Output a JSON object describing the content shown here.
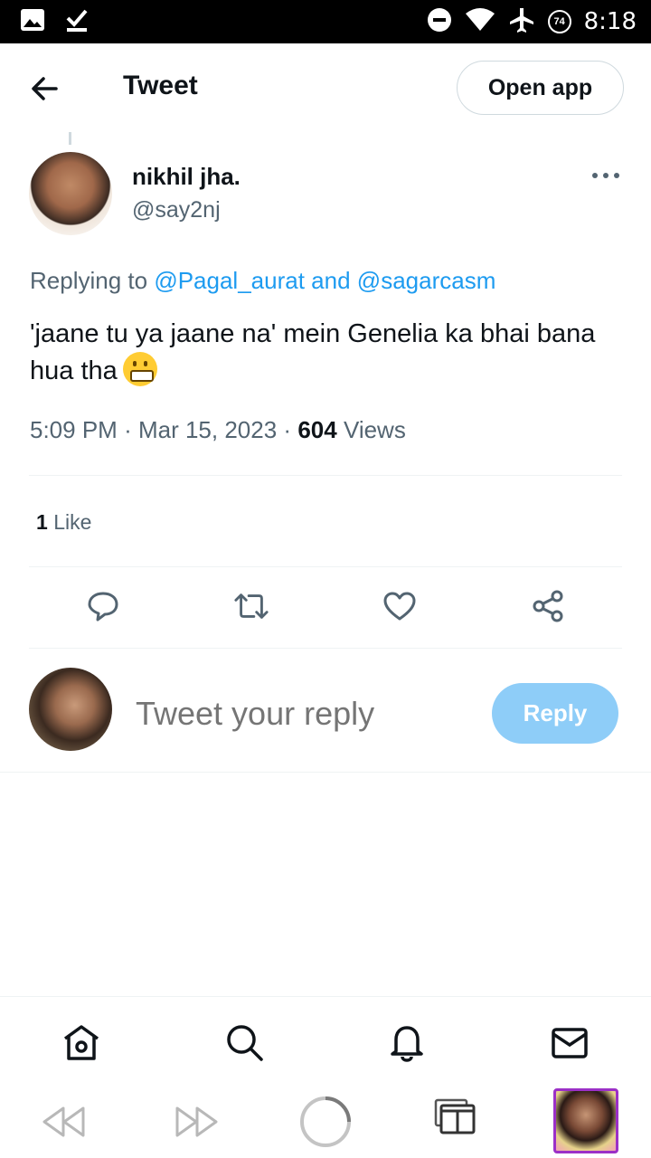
{
  "statusbar": {
    "time": "8:18",
    "battery_level": "74"
  },
  "header": {
    "title": "Tweet",
    "open_app_label": "Open app"
  },
  "tweet": {
    "author_name": "nikhil jha.",
    "author_handle": "@say2nj",
    "replying_prefix": "Replying to",
    "replying_to_1": "@Pagal_aurat",
    "replying_and": "and",
    "replying_to_2": "@sagarcasm",
    "text": "'jaane tu ya jaane na' mein Genelia ka bhai bana hua tha",
    "time": "5:09 PM",
    "date": "Mar 15, 2023",
    "views_count": "604",
    "views_label": "Views",
    "likes_count": "1",
    "likes_label": "Like"
  },
  "composer": {
    "placeholder": "Tweet your reply",
    "reply_label": "Reply"
  },
  "colors": {
    "accent": "#1d9bf0",
    "reply_button": "#8ecdf8",
    "secondary_text": "#536471"
  }
}
